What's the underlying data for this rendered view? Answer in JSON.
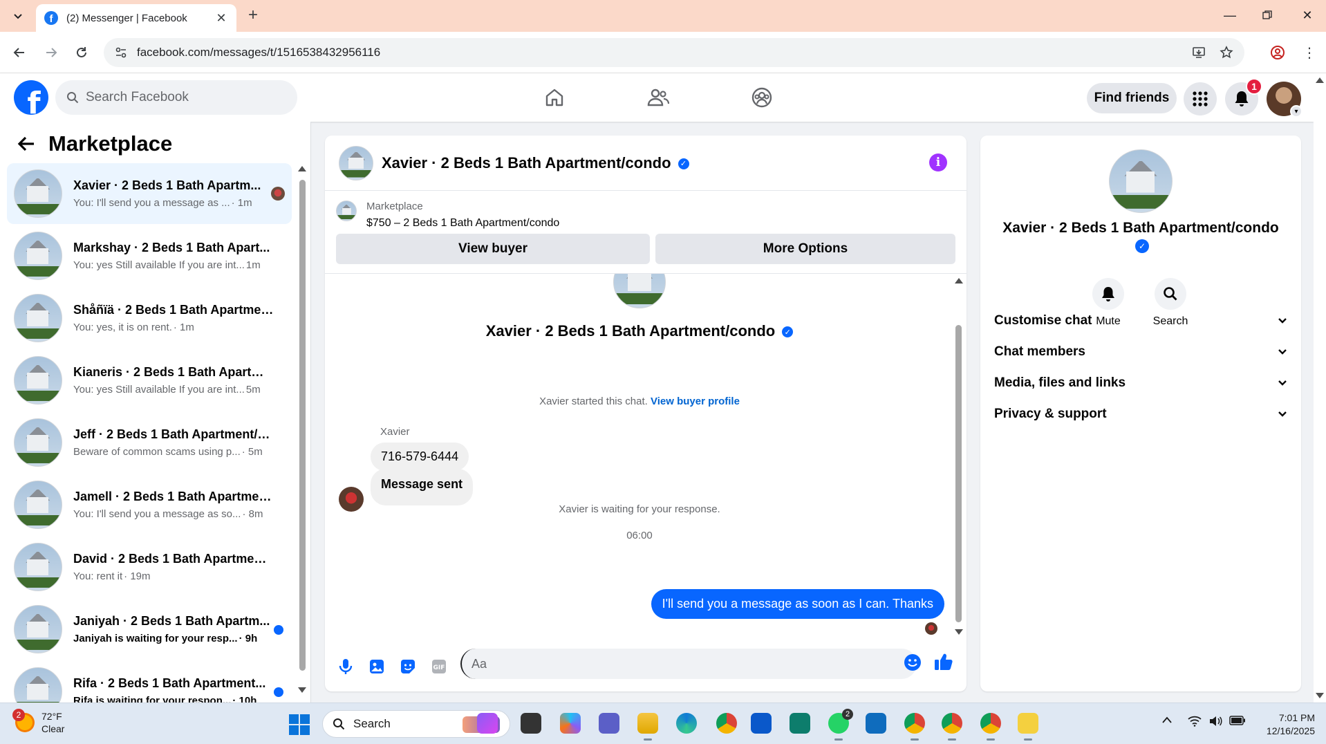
{
  "browser": {
    "tab_title": "(2) Messenger | Facebook",
    "url": "facebook.com/messages/t/1516538432956116"
  },
  "fb": {
    "search_placeholder": "Search Facebook",
    "find_friends": "Find friends",
    "notification_count": "1"
  },
  "sidebar": {
    "title": "Marketplace",
    "conversations": [
      {
        "name": "Xavier · 2 Beds 1 Bath Apartm...",
        "snippet": "You: I'll send you a message as ...",
        "time": "· 1m",
        "unread": false,
        "active": true
      },
      {
        "name": "Markshay · 2 Beds 1 Bath Apart...",
        "snippet": "You: yes Still available If you are int...",
        "time": "1m",
        "unread": false,
        "active": false
      },
      {
        "name": "Shåñïä · 2 Beds 1 Bath Apartmen...",
        "snippet": "You: yes, it is on rent.",
        "time": "· 1m",
        "unread": false,
        "active": false
      },
      {
        "name": "Kianeris · 2 Beds 1 Bath Apartme...",
        "snippet": "You: yes Still available If you are int...",
        "time": "5m",
        "unread": false,
        "active": false
      },
      {
        "name": "Jeff · 2 Beds 1 Bath Apartment/c...",
        "snippet": "Beware of common scams using p...",
        "time": "· 5m",
        "unread": false,
        "active": false
      },
      {
        "name": "Jamell · 2 Beds 1 Bath Apartmen...",
        "snippet": "You: I'll send you a message as so...",
        "time": "· 8m",
        "unread": false,
        "active": false
      },
      {
        "name": "David · 2 Beds 1 Bath Apartment...",
        "snippet": "You: rent it",
        "time": "· 19m",
        "unread": false,
        "active": false
      },
      {
        "name": "Janiyah · 2 Beds 1 Bath Apartm...",
        "snippet": "Janiyah is waiting for your resp...",
        "time": "· 9h",
        "unread": true,
        "active": false
      },
      {
        "name": "Rifa · 2 Beds 1 Bath Apartment...",
        "snippet": "Rifa is waiting for your respon...",
        "time": "· 10h",
        "unread": true,
        "active": false
      }
    ]
  },
  "chat": {
    "header_name": "Xavier · 2 Beds 1 Bath Apartment/condo",
    "listing_source": "Marketplace",
    "listing_title": "$750 – 2 Beds 1 Bath Apartment/condo",
    "view_buyer": "View buyer",
    "more_options": "More Options",
    "intro_name": "Xavier · 2 Beds 1 Bath Apartment/condo",
    "started_text": "Xavier started this chat.",
    "view_profile": "View buyer profile",
    "sender": "Xavier",
    "msg_phone": "716-579-6444",
    "msg_sent": "Message sent",
    "waiting_text": "Xavier is waiting for your response.",
    "timestamp": "06:00",
    "outgoing": "I'll send you a message as soon as I can. Thanks",
    "input_placeholder": "Aa"
  },
  "details": {
    "name": "Xavier · 2 Beds 1 Bath Apartment/condo",
    "mute": "Mute",
    "search": "Search",
    "sections": [
      "Customise chat",
      "Chat members",
      "Media, files and links",
      "Privacy & support"
    ]
  },
  "taskbar": {
    "temp": "72°F",
    "condition": "Clear",
    "weather_badge": "2",
    "search": "Search",
    "whatsapp_badge": "2",
    "time": "7:01 PM",
    "date": "12/16/2025"
  },
  "colors": {
    "fb_blue": "#0866ff",
    "tab_bar": "#fbd9c9",
    "info_purple": "#a033ff"
  }
}
